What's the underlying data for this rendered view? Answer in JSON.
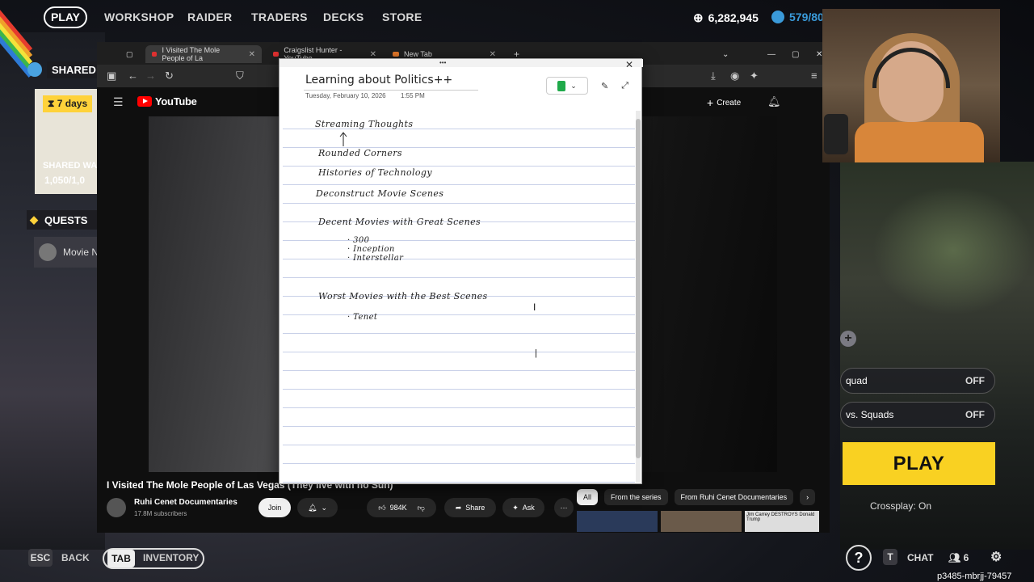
{
  "top_nav": {
    "play": "PLAY",
    "items": [
      "WORKSHOP",
      "RAIDER",
      "TRADERS",
      "DECKS",
      "STORE"
    ],
    "currency_1": "6,282,945",
    "currency_2": "579/80"
  },
  "left_panel": {
    "shared_header": "SHARED V",
    "days_badge": "7 days",
    "shared_wa": "SHARED WA",
    "shared_num": "1,050/1,0",
    "quests": "QUESTS",
    "movie_card": "Movie N"
  },
  "browser": {
    "tabs": [
      {
        "label": "I Visited The Mole People of La"
      },
      {
        "label": "Craigslist Hunter - YouTube"
      },
      {
        "label": "New Tab"
      }
    ],
    "youtube": {
      "logo_text": "YouTube",
      "create_label": "Create",
      "video_title": "I Visited The Mole People of Las Vegas (They live with no Sun)",
      "channel_name": "Ruhi Cenet Documentaries",
      "subscribers": "17.8M subscribers",
      "join": "Join",
      "likes": "984K",
      "share": "Share",
      "ask": "Ask",
      "chips": [
        "All",
        "From the series",
        "From Ruhi Cenet Documentaries"
      ],
      "thumb_caption": "Jim Carrey DESTROYS Donald Trump"
    }
  },
  "note": {
    "title": "Learning about Politics++",
    "date": "Tuesday, February 10, 2026",
    "time": "1:55 PM",
    "lines": [
      "Streaming Thoughts",
      "Rounded Corners",
      "Histories of Technology",
      "Deconstruct Movie Scenes",
      "Decent Movies with Great Scenes",
      "· 300",
      "· Inception",
      "· Interstellar",
      "Worst Movies with the Best Scenes",
      "· Tenet"
    ]
  },
  "right_panel": {
    "row_1_label": "quad",
    "row_1_value": "OFF",
    "row_2_label": "vs. Squads",
    "row_2_value": "OFF",
    "play": "PLAY",
    "crossplay": "Crossplay: On"
  },
  "bottom_bar": {
    "esc_key": "ESC",
    "back": "BACK",
    "tab_key": "TAB",
    "inventory": "INVENTORY",
    "chat_key": "T",
    "chat": "CHAT",
    "friends_count": "6",
    "session_id": "p3485-mbrjj-79457"
  },
  "colors": {
    "play_yellow": "#f9d122",
    "youtube_red": "#ff0000",
    "notebook_green": "#1faa4a",
    "ruled_line": "#c8d0e8"
  },
  "icons": [
    "gear-icon",
    "hourglass-icon",
    "quest-icon",
    "coin-icon",
    "youtube-logo-icon",
    "bell-icon",
    "thumbs-up-icon",
    "thumbs-down-icon",
    "share-icon",
    "sparkle-icon",
    "more-icon",
    "close-icon",
    "expand-icon",
    "pen-icon",
    "help-icon",
    "friends-icon",
    "settings-icon"
  ]
}
